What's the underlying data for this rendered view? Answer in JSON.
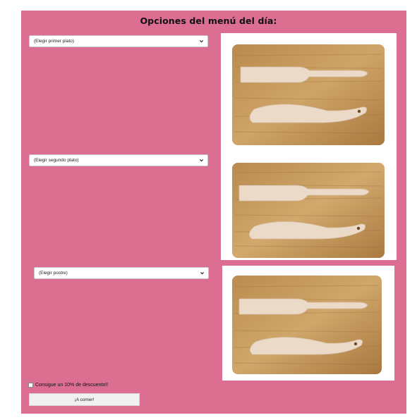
{
  "header": {
    "title": "Opciones del menú del día:"
  },
  "menu": {
    "first_course": {
      "placeholder": "(Elegir primer plato)"
    },
    "second_course": {
      "placeholder": "(Elegir segundo plato)"
    },
    "dessert": {
      "placeholder": "(Elegir postre)"
    }
  },
  "discount": {
    "label": "Consigue un 10% de descuento!!",
    "checked": false
  },
  "submit": {
    "label": "¡A comer!"
  },
  "icons": {
    "dropdown": "chevron-down-icon",
    "dish_photo": "cutting-board-with-wooden-utensils"
  },
  "colors": {
    "panel_background": "#dc6e92",
    "board_wood": "#c79b5e",
    "utensil_wood": "#ecdac8"
  }
}
